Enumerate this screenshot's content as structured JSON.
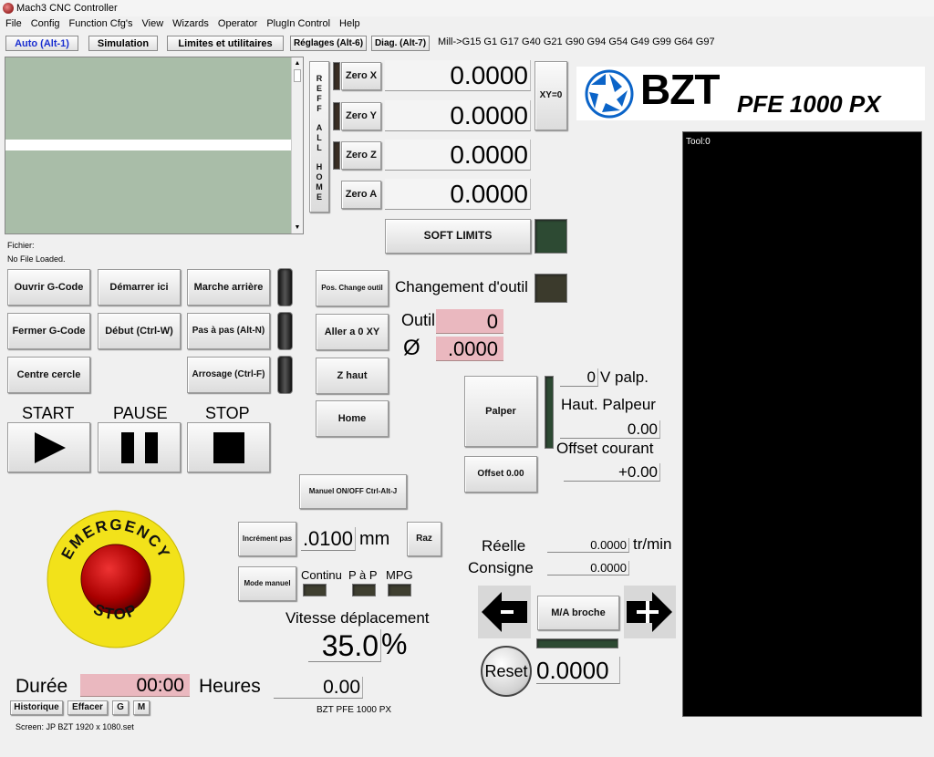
{
  "window": {
    "title": "Mach3 CNC Controller"
  },
  "menu": [
    "File",
    "Config",
    "Function Cfg's",
    "View",
    "Wizards",
    "Operator",
    "PlugIn Control",
    "Help"
  ],
  "tabs": {
    "auto": "Auto (Alt-1)",
    "simulation": "Simulation",
    "limits": "Limites et utilitaires",
    "settings": "Réglages (Alt-6)",
    "diag": "Diag. (Alt-7)"
  },
  "gcode_status": "Mill->G15  G1 G17 G40 G21 G90 G94 G54 G49 G99 G64 G97",
  "file": {
    "label": "Fichier:",
    "value": "No File Loaded."
  },
  "ref_all_home": [
    "R",
    "E",
    "F",
    "F",
    "",
    "A",
    "L",
    "L",
    "",
    "H",
    "O",
    "M",
    "E"
  ],
  "axes": [
    {
      "button": "Zero X",
      "value": "0.0000"
    },
    {
      "button": "Zero Y",
      "value": "0.0000"
    },
    {
      "button": "Zero Z",
      "value": "0.0000"
    },
    {
      "button": "Zero A",
      "value": "0.0000"
    }
  ],
  "xy0": "XY=0",
  "soft_limits": "SOFT    LIMITS",
  "logo": {
    "brand": "BZT",
    "model": "PFE 1000 PX",
    "accent": "#0b64c8"
  },
  "tool_label": "Tool:0",
  "program_buttons": {
    "open": "Ouvrir G-Code",
    "start_here": "Démarrer ici",
    "reverse": "Marche arrière",
    "close": "Fermer G-Code",
    "rewind": "Début (Ctrl-W)",
    "single_step": "Pas à pas (Alt-N)",
    "center_circle": "Centre cercle",
    "coolant": "Arrosage (Ctrl-F)"
  },
  "cycle": {
    "start": "START",
    "pause": "PAUSE",
    "stop": "STOP"
  },
  "tool_change": {
    "pos_button": "Pos. Change outil",
    "label": "Changement d'outil",
    "goto_xy": "Aller a 0 XY",
    "z_up": "Z haut",
    "home": "Home",
    "tool_label": "Outil",
    "tool_value": "0",
    "dia_symbol": "Ø",
    "dia_value": ".0000"
  },
  "probe": {
    "button": "Palper",
    "offset_button": "Offset 0.00",
    "v_value": "0",
    "v_label": "V palp.",
    "height_label": "Haut. Palpeur",
    "height_value": "0.00",
    "offset_label": "Offset courant",
    "offset_value": "+0.00"
  },
  "jog": {
    "manual_toggle": "Manuel ON/OFF Ctrl-Alt-J",
    "increment_button": "Incrément pas",
    "increment_value": ".0100",
    "unit": "mm",
    "reset": "Raz",
    "mode_button": "Mode manuel",
    "modes": [
      "Continu",
      "P à P",
      "MPG"
    ],
    "speed_label": "Vitesse déplacement",
    "speed_value": "35.0",
    "speed_unit": "%"
  },
  "spindle": {
    "real_label": "Réelle",
    "real_value": "0.0000",
    "real_unit": "tr/min",
    "set_label": "Consigne",
    "set_value": "0.0000",
    "toggle": "M/A broche",
    "minus": "-",
    "plus": "+",
    "reset": "Reset",
    "override": "0.0000"
  },
  "emergency": {
    "top": "EMERGENCY",
    "bottom": "STOP"
  },
  "duration": {
    "label": "Durée",
    "value": "00:00",
    "hours_label": "Heures",
    "hours_value": "0.00"
  },
  "bottom_buttons": {
    "history": "Historique",
    "clear": "Effacer",
    "g": "G",
    "m": "M"
  },
  "screen_name": "Screen: JP  BZT  1920 x 1080.set",
  "footer_brand": "BZT  PFE  1000  PX"
}
